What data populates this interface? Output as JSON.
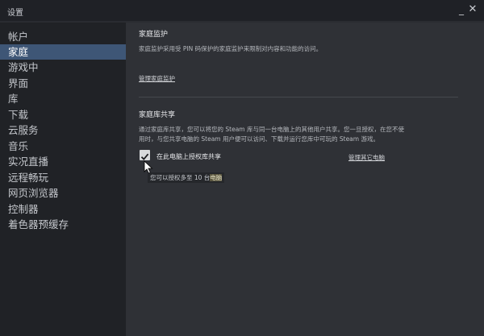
{
  "window": {
    "title": "设置",
    "minimize_glyph": "_",
    "close_glyph": "✕"
  },
  "sidebar": {
    "items": [
      {
        "label": "帐户"
      },
      {
        "label": "家庭",
        "active": true
      },
      {
        "label": "游戏中"
      },
      {
        "label": "界面"
      },
      {
        "label": "库"
      },
      {
        "label": "下载"
      },
      {
        "label": "云服务"
      },
      {
        "label": "音乐"
      },
      {
        "label": "实况直播"
      },
      {
        "label": "远程畅玩"
      },
      {
        "label": "网页浏览器"
      },
      {
        "label": "控制器"
      },
      {
        "label": "着色器预缓存"
      }
    ]
  },
  "family_view": {
    "heading": "家庭监护",
    "description": "家庭监护采用受 PIN 码保护的家庭监护来限制对内容和功能的访问。",
    "manage_link": "管理家庭监护"
  },
  "library_sharing": {
    "heading": "家庭库共享",
    "description_line1": "通过家庭库共享，您可以将您的 Steam 库与同一台电脑上的其他用户共享。您一旦授权，在您不使",
    "description_line2": "用时，与您共享电脑的 Steam 用户便可以访问、下载并运行您库中可玩的 Steam 游戏。",
    "checkbox_label": "在此电脑上授权库共享",
    "checkbox_checked": true,
    "manage_other_link": "管理其它电脑",
    "note_prefix": "您可以授权多至 10 台",
    "note_highlight": "电脑"
  },
  "colors": {
    "sidebar_active": "#3e5676",
    "window_bg": "#2f3136",
    "sidebar_bg": "#202226"
  }
}
